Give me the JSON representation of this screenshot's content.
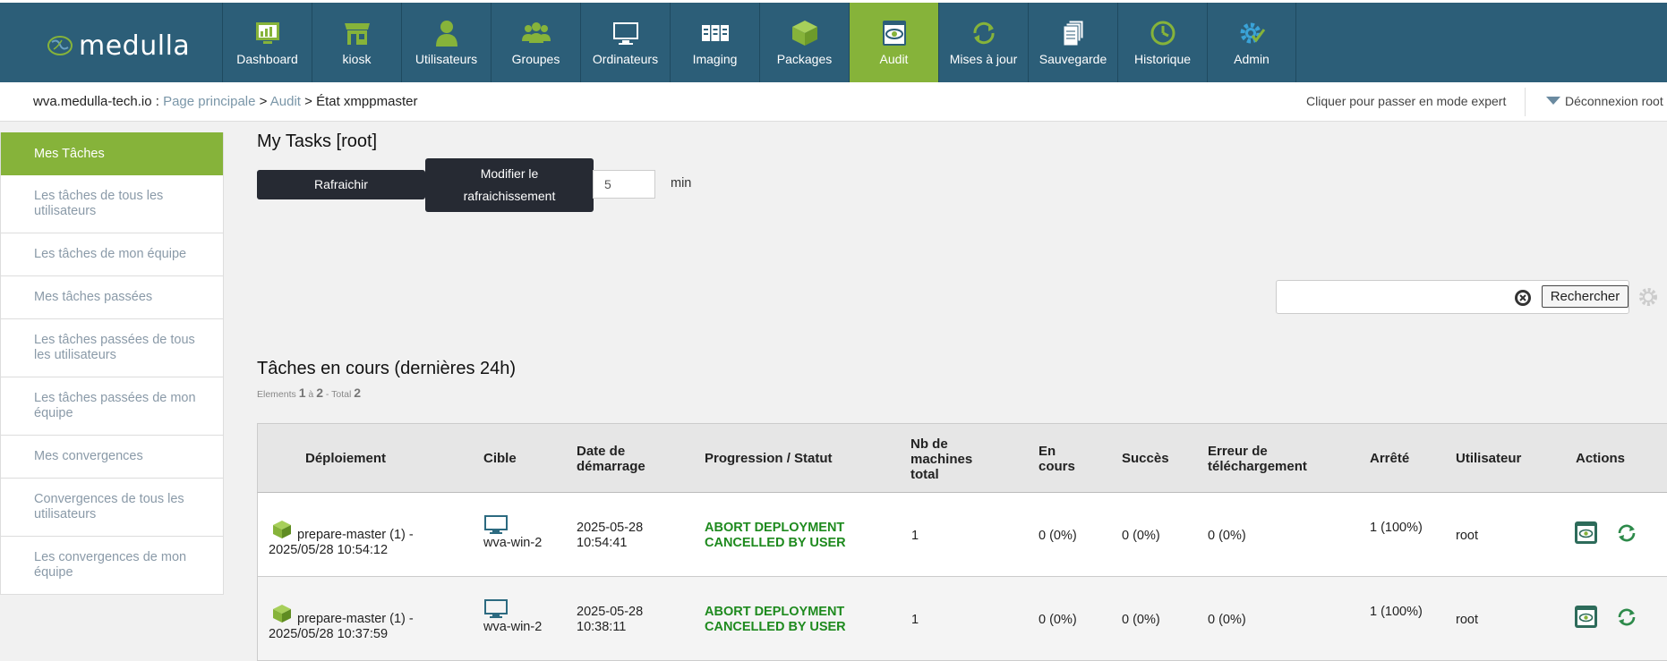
{
  "brand": {
    "logo_text": "medulla",
    "accent": "#86b33a",
    "header_bg": "#2c5e78"
  },
  "nav": [
    {
      "label": "Dashboard",
      "icon": "dashboard-icon"
    },
    {
      "label": "kiosk",
      "icon": "kiosk-icon"
    },
    {
      "label": "Utilisateurs",
      "icon": "user-icon"
    },
    {
      "label": "Groupes",
      "icon": "group-icon"
    },
    {
      "label": "Ordinateurs",
      "icon": "computer-icon"
    },
    {
      "label": "Imaging",
      "icon": "imaging-icon"
    },
    {
      "label": "Packages",
      "icon": "package-icon"
    },
    {
      "label": "Audit",
      "icon": "audit-icon",
      "active": true
    },
    {
      "label": "Mises à jour",
      "icon": "update-icon"
    },
    {
      "label": "Sauvegarde",
      "icon": "backup-icon"
    },
    {
      "label": "Historique",
      "icon": "history-icon"
    },
    {
      "label": "Admin",
      "icon": "admin-gear-icon"
    }
  ],
  "breadcrumb": {
    "host": "wva.medulla-tech.io",
    "separator": ":",
    "home": "Page principale",
    "section": "Audit",
    "current": "État xmppmaster"
  },
  "header_right": {
    "expert_mode": "Cliquer pour passer en mode expert",
    "logout": "Déconnexion root"
  },
  "sidebar": {
    "items": [
      "Mes Tâches",
      "Les tâches de tous les utilisateurs",
      "Les tâches de mon équipe",
      "Mes tâches passées",
      "Les tâches passées de tous les utilisateurs",
      "Les tâches passées de mon équipe",
      "Mes convergences",
      "Convergences de tous les utilisateurs",
      "Les convergences de mon équipe"
    ]
  },
  "page": {
    "title": "My Tasks [root]",
    "refresh_button": "Rafraichir",
    "modify_refresh_button": "Modifier le rafraichissement",
    "refresh_value": "5",
    "refresh_unit": "min",
    "search_button": "Rechercher",
    "search_value": ""
  },
  "section": {
    "title": "Tâches en cours (dernières 24h)",
    "elements_prefix": "Elements",
    "from": "1",
    "to_word": "à",
    "to": "2",
    "total_word": "- Total",
    "total": "2"
  },
  "table": {
    "headers": {
      "deploiement": "Déploiement",
      "cible": "Cible",
      "date": "Date de démarrage",
      "progression": "Progression / Statut",
      "nb": "Nb de machines total",
      "en_cours": "En cours",
      "succes": "Succès",
      "erreur": "Erreur de téléchargement",
      "arrete": "Arrêté",
      "utilisateur": "Utilisateur",
      "actions": "Actions"
    },
    "rows": [
      {
        "deploiement": "prepare-master (1) - 2025/05/28 10:54:12",
        "cible": "wva-win-2",
        "date": "2025-05-28 10:54:41",
        "statut": "ABORT DEPLOYMENT CANCELLED BY USER",
        "nb": "1",
        "en_cours": "0 (0%)",
        "succes": "0 (0%)",
        "erreur": "0 (0%)",
        "arrete": "1 (100%)",
        "utilisateur": "root"
      },
      {
        "deploiement": "prepare-master (1) - 2025/05/28 10:37:59",
        "cible": "wva-win-2",
        "date": "2025-05-28 10:38:11",
        "statut": "ABORT DEPLOYMENT CANCELLED BY USER",
        "nb": "1",
        "en_cours": "0 (0%)",
        "succes": "0 (0%)",
        "erreur": "0 (0%)",
        "arrete": "1 (100%)",
        "utilisateur": "root"
      }
    ]
  }
}
